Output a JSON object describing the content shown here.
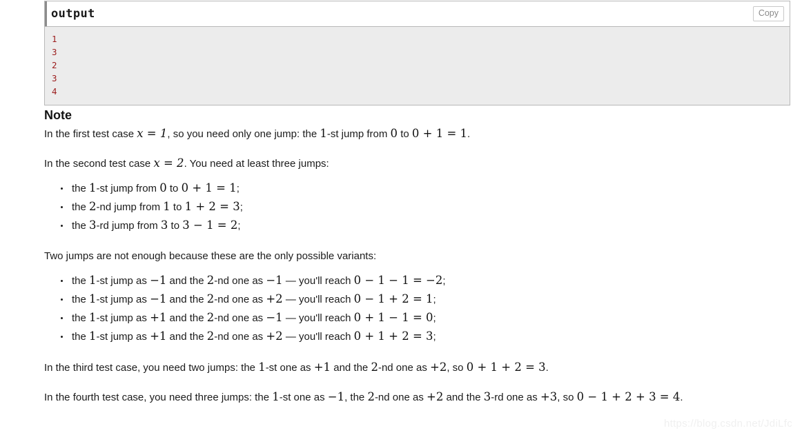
{
  "output_panel": {
    "title": "output",
    "copy_label": "Copy",
    "lines": [
      "1",
      "3",
      "2",
      "3",
      "4"
    ],
    "code_color": "#9b1c1c",
    "body_background": "#ececec"
  },
  "note": {
    "heading": "Note",
    "paragraph_1": {
      "prefix": "In the first test case ",
      "math_1": "x = 1",
      "middle": ", so you need only one jump: the ",
      "math_2": "1",
      "middle_2": "-st jump from ",
      "math_3": "0",
      "middle_3": " to ",
      "math_4": "0 + 1 = 1",
      "suffix": "."
    },
    "paragraph_2": {
      "prefix": "In the second test case ",
      "math_1": "x = 2",
      "suffix": ". You need at least three jumps:"
    },
    "list_1": [
      {
        "prefix": "the ",
        "ordinal_num": "1",
        "ordinal_suffix": "-st jump from ",
        "from": "0",
        "to_word": " to ",
        "expr": "0 + 1 = 1",
        "punct": ";"
      },
      {
        "prefix": "the ",
        "ordinal_num": "2",
        "ordinal_suffix": "-nd jump from ",
        "from": "1",
        "to_word": " to ",
        "expr": "1 + 2 = 3",
        "punct": ";"
      },
      {
        "prefix": "the ",
        "ordinal_num": "3",
        "ordinal_suffix": "-rd jump from ",
        "from": "3",
        "to_word": " to ",
        "expr": "3 − 1 = 2",
        "punct": ";"
      }
    ],
    "paragraph_3": "Two jumps are not enough because these are the only possible variants:",
    "list_2": [
      {
        "prefix": "the ",
        "first_num": "1",
        "first_suffix": "-st jump as ",
        "first_val": "−1",
        "conj": " and the ",
        "second_num": "2",
        "second_suffix": "-nd one as ",
        "second_val": "−1",
        "dash": " — ",
        "reach": "you'll reach ",
        "expr": "0 − 1 − 1 = −2",
        "punct": ";"
      },
      {
        "prefix": "the ",
        "first_num": "1",
        "first_suffix": "-st jump as ",
        "first_val": "−1",
        "conj": " and the ",
        "second_num": "2",
        "second_suffix": "-nd one as ",
        "second_val": "+2",
        "dash": " — ",
        "reach": "you'll reach ",
        "expr": "0 − 1 + 2 = 1",
        "punct": ";"
      },
      {
        "prefix": "the ",
        "first_num": "1",
        "first_suffix": "-st jump as ",
        "first_val": "+1",
        "conj": " and the ",
        "second_num": "2",
        "second_suffix": "-nd one as ",
        "second_val": "−1",
        "dash": " — ",
        "reach": "you'll reach ",
        "expr": "0 + 1 − 1 = 0",
        "punct": ";"
      },
      {
        "prefix": "the ",
        "first_num": "1",
        "first_suffix": "-st jump as ",
        "first_val": "+1",
        "conj": " and the ",
        "second_num": "2",
        "second_suffix": "-nd one as ",
        "second_val": "+2",
        "dash": " — ",
        "reach": "you'll reach ",
        "expr": "0 + 1 + 2 = 3",
        "punct": ";"
      }
    ],
    "paragraph_4": {
      "prefix": "In the third test case, you need two jumps: the ",
      "num_1": "1",
      "text_1": "-st one as ",
      "val_1": "+1",
      "text_2": " and the ",
      "num_2": "2",
      "text_3": "-nd one as ",
      "val_2": "+2",
      "text_4": ", so ",
      "expr": "0 + 1 + 2 = 3",
      "suffix": "."
    },
    "paragraph_5": {
      "prefix": "In the fourth test case, you need three jumps: the ",
      "num_1": "1",
      "text_1": "-st one as ",
      "val_1": "−1",
      "text_2": ", the ",
      "num_2": "2",
      "text_3": "-nd one as ",
      "val_2": "+2",
      "text_4": " and the ",
      "num_3": "3",
      "text_5": "-rd one as ",
      "val_3": "+3",
      "text_6": ", so ",
      "expr": "0 − 1 + 2 + 3 = 4",
      "suffix": "."
    }
  },
  "watermark": {
    "text": "https://blog.csdn.net/JdiLfc",
    "color": "#f0f0f0"
  }
}
